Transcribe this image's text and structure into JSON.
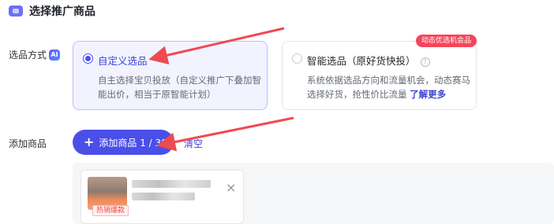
{
  "section": {
    "title": "选择推广商品"
  },
  "selection_mode": {
    "label": "选品方式",
    "ai_badge": "AI",
    "options": [
      {
        "title": "自定义选品",
        "description": "自主选择宝贝投放（自定义推广下叠加智能出价，相当于原智能计划）",
        "selected": true
      },
      {
        "title": "智能选品（原好货快投）",
        "description": "系统依据选品方向和流量机会，动态赛马选择好货，抢性价比流量",
        "link": "了解更多",
        "badge": "动态优选机会品",
        "help_icon": "?",
        "selected": false
      }
    ]
  },
  "add_product": {
    "label": "添加商品",
    "button_label": "添加商品 1 / 30",
    "clear_label": "清空"
  },
  "product_list": {
    "items": [
      {
        "tag": "热销爆款"
      }
    ]
  },
  "colors": {
    "accent": "#4a4fe8",
    "annotation_arrow": "#ef4a52",
    "badge": "#f5455b"
  }
}
